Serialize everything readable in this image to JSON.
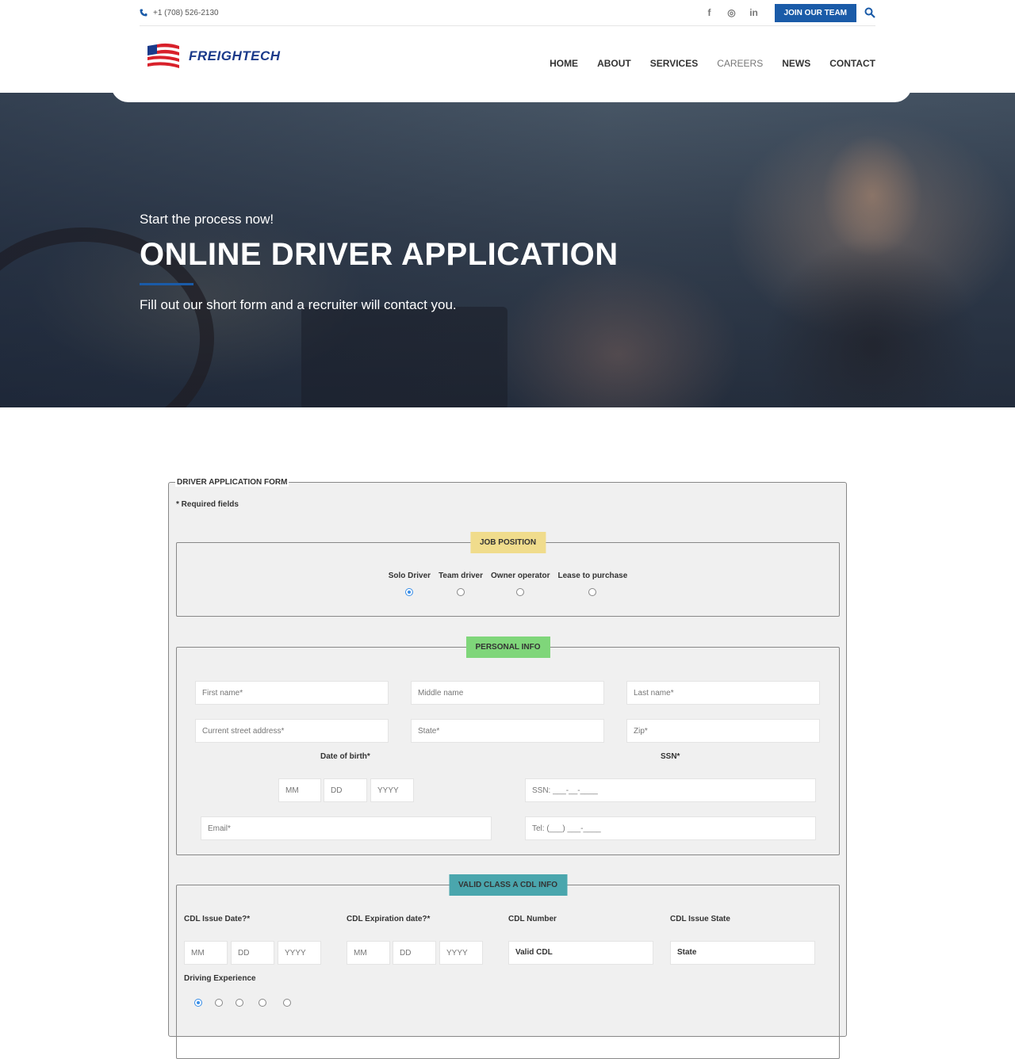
{
  "topbar": {
    "phone": "+1 (708) 526-2130",
    "social": [
      "f",
      "◎",
      "in"
    ],
    "join_label": "JOIN OUR TEAM"
  },
  "header": {
    "brand": "FREIGHTECH",
    "nav": [
      "HOME",
      "ABOUT",
      "SERVICES",
      "CAREERS",
      "NEWS",
      "CONTACT"
    ],
    "active_nav": "CAREERS"
  },
  "hero": {
    "subtitle": "Start the process now!",
    "title": "ONLINE DRIVER APPLICATION",
    "lead": "Fill out our short form and a recruiter will contact you."
  },
  "form": {
    "legend": "DRIVER APPLICATION FORM",
    "required_note": "* Required fields",
    "job_position": {
      "tag": "JOB POSITION",
      "tag_color": "#f0dc8c",
      "options": [
        "Solo Driver",
        "Team driver",
        "Owner operator",
        "Lease to purchase"
      ],
      "selected": "Solo Driver"
    },
    "personal_info": {
      "tag": "PERSONAL INFO",
      "tag_color": "#7fd67a",
      "first_name": "First name*",
      "middle_name": "Middle name",
      "last_name": "Last name*",
      "street": "Current street address*",
      "state": "State*",
      "zip": "Zip*",
      "dob_label": "Date of birth*",
      "dob_mm": "MM",
      "dob_dd": "DD",
      "dob_yyyy": "YYYY",
      "ssn_label": "SSN*",
      "ssn": "SSN: ___-__-____",
      "email": "Email*",
      "tel": "Tel: (___) ___-____"
    },
    "cdl_info": {
      "tag": "VALID CLASS A CDL INFO",
      "tag_color": "#4aa6ad",
      "issue_date_label": "CDL Issue Date?*",
      "expiration_label": "CDL Expiration date?*",
      "number_label": "CDL Number",
      "state_label": "CDL Issue State",
      "mm": "MM",
      "dd": "DD",
      "yyyy": "YYYY",
      "number_value": "Valid CDL",
      "state_value": "State",
      "experience_label": "Driving Experience",
      "experience_selected_index": 0
    }
  }
}
